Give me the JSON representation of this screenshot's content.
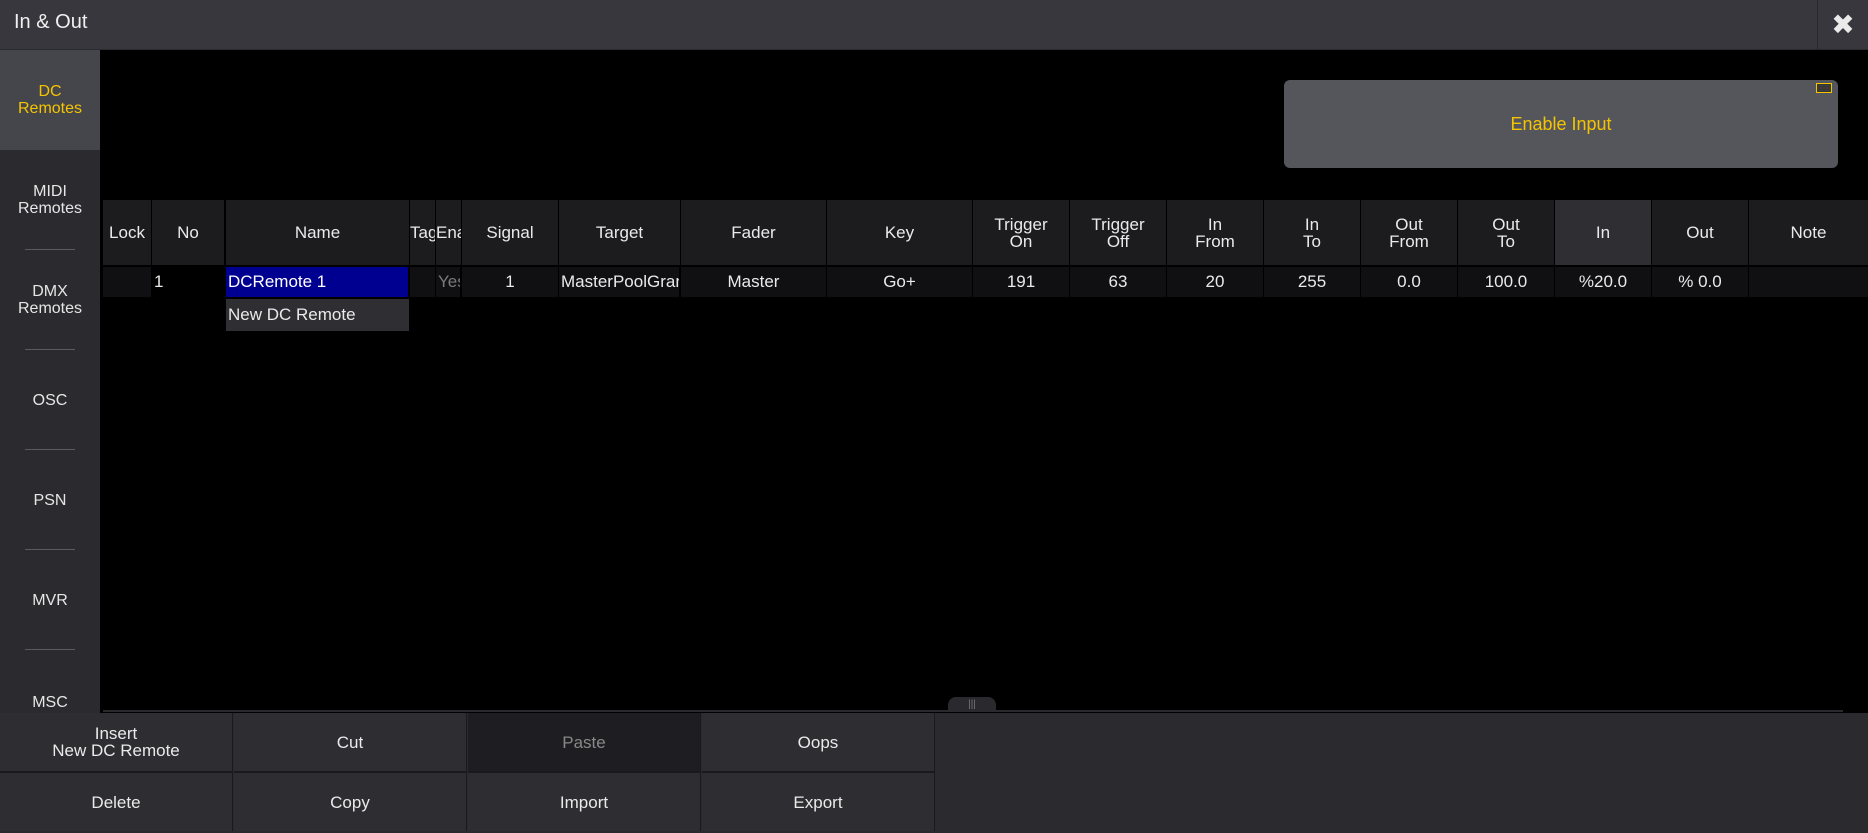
{
  "window": {
    "title": "In & Out",
    "close_icon": "close-icon"
  },
  "sidebar": {
    "items": [
      {
        "label": "DC\nRemotes",
        "active": true
      },
      {
        "label": "MIDI\nRemotes",
        "active": false
      },
      {
        "label": "DMX\nRemotes",
        "active": false
      },
      {
        "label": "OSC",
        "active": false
      },
      {
        "label": "PSN",
        "active": false
      },
      {
        "label": "MVR",
        "active": false
      },
      {
        "label": "MSC",
        "active": false
      }
    ]
  },
  "enable_input": {
    "label": "Enable Input"
  },
  "table": {
    "columns": [
      "Lock",
      "No",
      "Name",
      "Tag",
      "Enabled",
      "Signal",
      "Target",
      "Fader",
      "Key",
      "Trigger\nOn",
      "Trigger\nOff",
      "In\nFrom",
      "In\nTo",
      "Out\nFrom",
      "Out\nTo",
      "In",
      "Out",
      "Note"
    ],
    "rows": [
      [
        "",
        "1",
        "DCRemote 1",
        "",
        "Yes",
        "1",
        "MasterPoolGrand",
        "Master",
        "Go+",
        "191",
        "63",
        "20",
        "255",
        "0.0",
        "100.0",
        "%20.0",
        "% 0.0",
        ""
      ]
    ],
    "new_row_label": "New DC Remote"
  },
  "toolbar": {
    "insert": "Insert\nNew DC Remote",
    "cut": "Cut",
    "paste": "Paste",
    "oops": "Oops",
    "delete": "Delete",
    "copy": "Copy",
    "import": "Import",
    "export": "Export"
  },
  "colors": {
    "accent": "#f5c400",
    "selection": "#000090",
    "background": "#000000"
  }
}
